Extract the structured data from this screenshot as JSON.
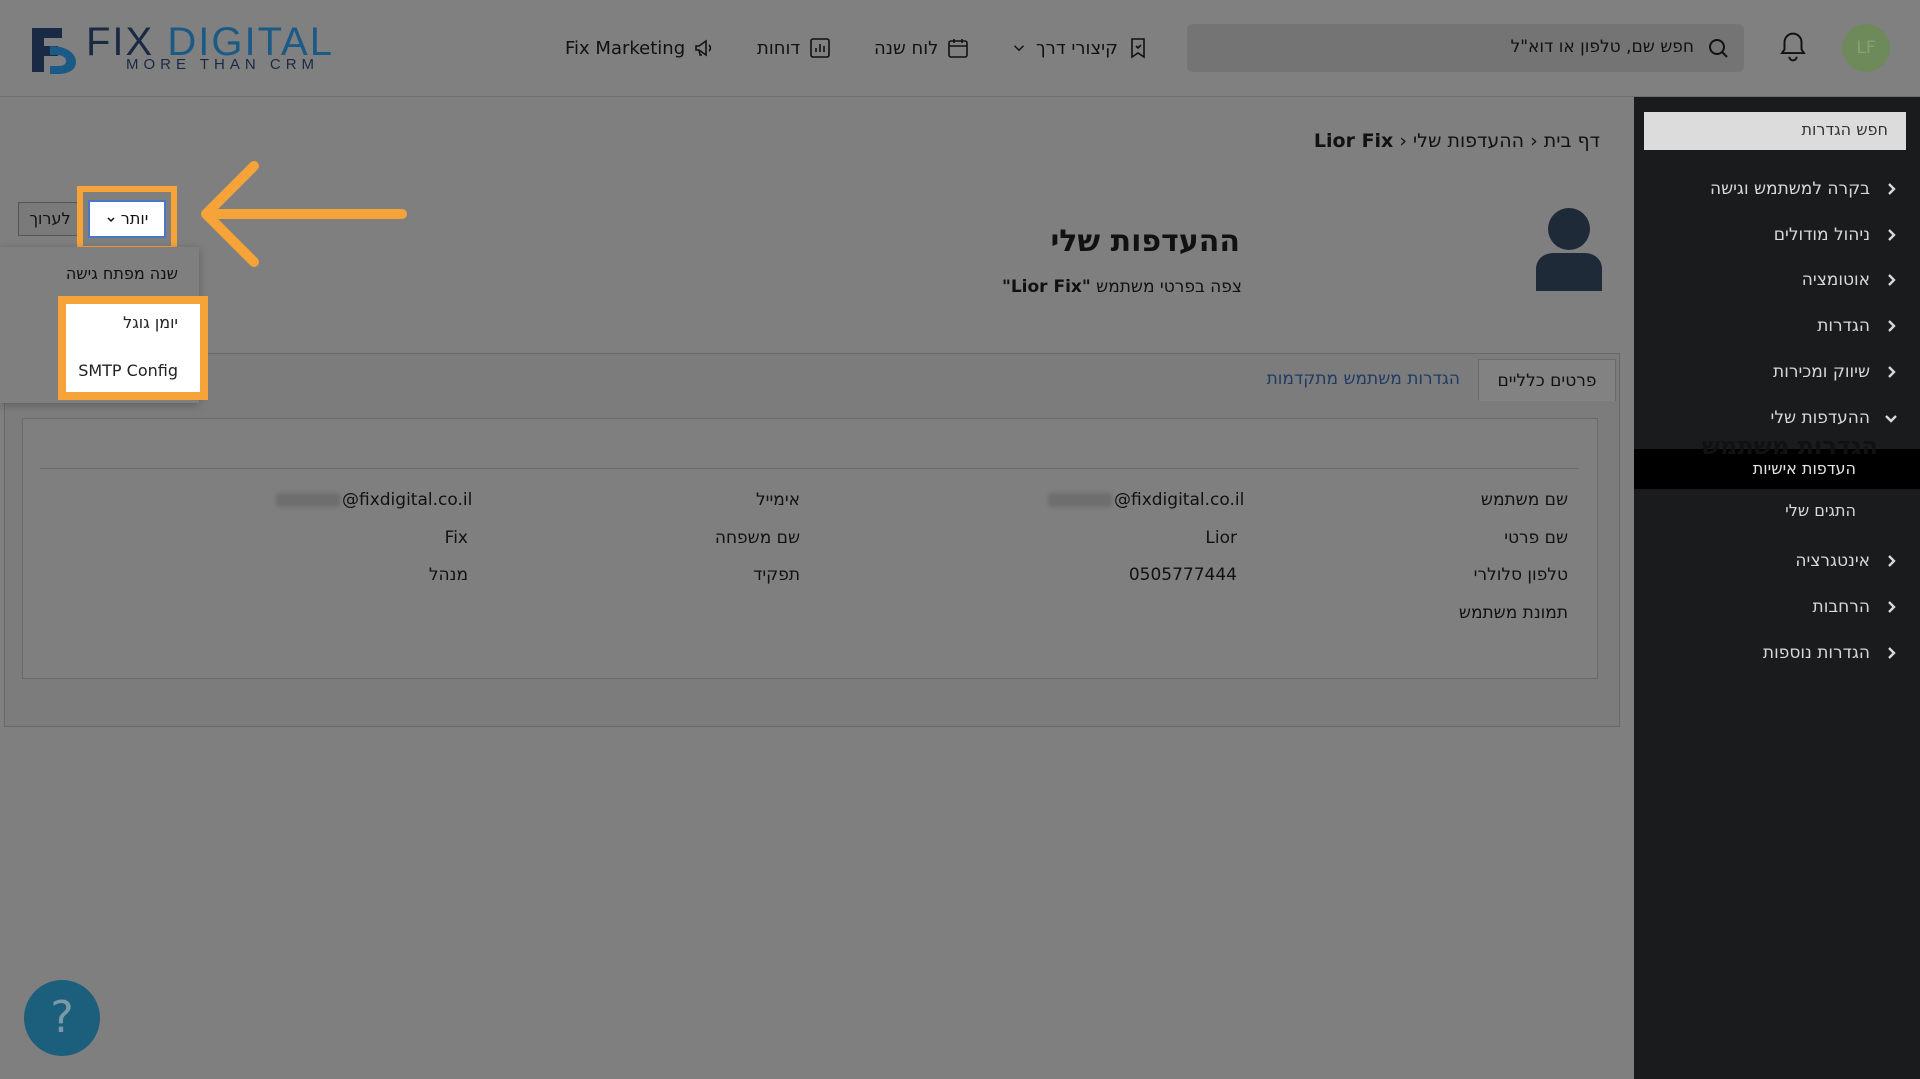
{
  "header": {
    "logo_main_a": "FIX ",
    "logo_main_b": "DIGITAL",
    "logo_sub": "MORE THAN CRM",
    "nav": {
      "marketing": "Fix Marketing",
      "reports": "דוחות",
      "calendar": "לוח שנה",
      "shortcuts": "קיצורי דרך"
    },
    "search_placeholder": "חפש שם, טלפון או דוא\"ל",
    "avatar_initials": "LF"
  },
  "sidebar": {
    "search": "חפש הגדרות",
    "items": [
      {
        "label": "בקרה למשתמש וגישה"
      },
      {
        "label": "ניהול מודולים"
      },
      {
        "label": "אוטומציה"
      },
      {
        "label": "הגדרות"
      },
      {
        "label": "שיווק ומכירות"
      },
      {
        "label": "ההעדפות שלי"
      }
    ],
    "sub_items": [
      {
        "label": "העדפות אישיות"
      },
      {
        "label": "התגים שלי"
      }
    ],
    "items_after": [
      {
        "label": "אינטגרציה"
      },
      {
        "label": "הרחבות"
      },
      {
        "label": "הגדרות נוספות"
      }
    ]
  },
  "breadcrumb": {
    "home": "דף בית",
    "prefs": "ההעדפות שלי",
    "user": "Lior Fix",
    "sep": "‹"
  },
  "page": {
    "title": "ההעדפות שלי",
    "subtitle_prefix": "צפה בפרטי משתמש",
    "subtitle_user": "\"Lior Fix\""
  },
  "toolbar": {
    "edit": "לערוך",
    "more": "יותר"
  },
  "dropdown": {
    "items": [
      "שנה מפתח גישה",
      "יומן גוגל",
      "SMTP Config"
    ]
  },
  "tabs": {
    "general": "פרטים כלליים",
    "advanced": "הגדרות משתמש מתקדמות"
  },
  "card": {
    "title": "הגדרות משתמש",
    "fields": {
      "username_label": "שם משתמש",
      "username_value": "@fixdigital.co.il",
      "email_label": "אימייל",
      "email_value": "@fixdigital.co.il",
      "firstname_label": "שם פרטי",
      "firstname_value": "Lior",
      "lastname_label": "שם משפחה",
      "lastname_value": "Fix",
      "phone_label": "טלפון סלולרי",
      "phone_value": "0505777444",
      "role_label": "תפקיד",
      "role_value": "מנהל",
      "photo_label": "תמונת משתמש"
    }
  },
  "help": "?",
  "colors": {
    "highlight": "#f6a33a",
    "sidebar_bg": "#191b1d",
    "link": "#1f3b63"
  }
}
